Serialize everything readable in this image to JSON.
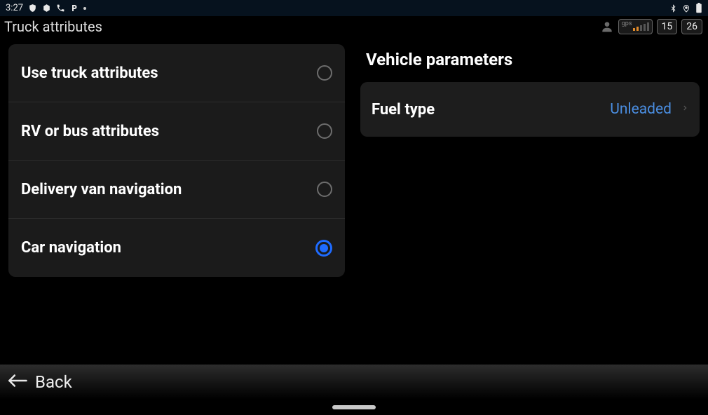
{
  "status": {
    "time": "3:27",
    "icons_left": [
      "shield-icon",
      "hexagon-icon",
      "phone-icon",
      "p-icon",
      "dot-icon"
    ],
    "icons_right": [
      "bluetooth-icon",
      "location-icon",
      "battery-icon"
    ]
  },
  "header": {
    "title": "Truck attributes",
    "gps_label": "gps",
    "signal_bars_on": 2,
    "signal_bars_total": 5,
    "badge_a": "15",
    "badge_b": "26"
  },
  "options": [
    {
      "label": "Use truck attributes",
      "selected": false
    },
    {
      "label": "RV or bus attributes",
      "selected": false
    },
    {
      "label": "Delivery van navigation",
      "selected": false
    },
    {
      "label": "Car navigation",
      "selected": true
    }
  ],
  "right": {
    "section_title": "Vehicle parameters",
    "rows": [
      {
        "label": "Fuel type",
        "value": "Unleaded"
      }
    ]
  },
  "back_label": "Back"
}
